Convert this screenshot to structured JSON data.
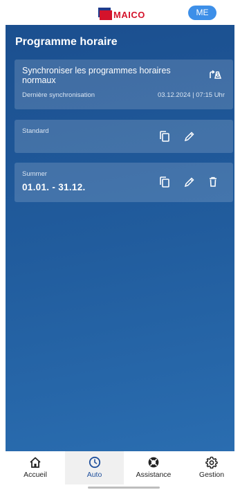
{
  "header": {
    "logo_text": "MAICO",
    "avatar_initials": "ME",
    "brand_colors": {
      "red": "#d4132b",
      "blue": "#1f3b8c",
      "avatar": "#3d8fe8"
    }
  },
  "main": {
    "title": "Programme horaire",
    "sync_card": {
      "title": "Synchroniser les programmes horaires normaux",
      "last_sync_label": "Dernière synchronisation",
      "last_sync_value": "03.12.2024 | 07:15 Uhr",
      "icon": "sync-schedule-icon"
    },
    "programs": [
      {
        "label": "Standard",
        "range": "",
        "actions": [
          "copy-icon",
          "edit-icon"
        ]
      },
      {
        "label": "Summer",
        "range": "01.01. - 31.12.",
        "actions": [
          "copy-icon",
          "edit-icon",
          "delete-icon"
        ]
      }
    ]
  },
  "bottom_nav": {
    "items": [
      {
        "label": "Accueil",
        "icon": "home-icon",
        "active": false
      },
      {
        "label": "Auto",
        "icon": "clock-icon",
        "active": true
      },
      {
        "label": "Assistance",
        "icon": "lifebuoy-icon",
        "active": false
      },
      {
        "label": "Gestion",
        "icon": "gear-icon",
        "active": false
      }
    ],
    "active_color": "#1f4f9c"
  }
}
